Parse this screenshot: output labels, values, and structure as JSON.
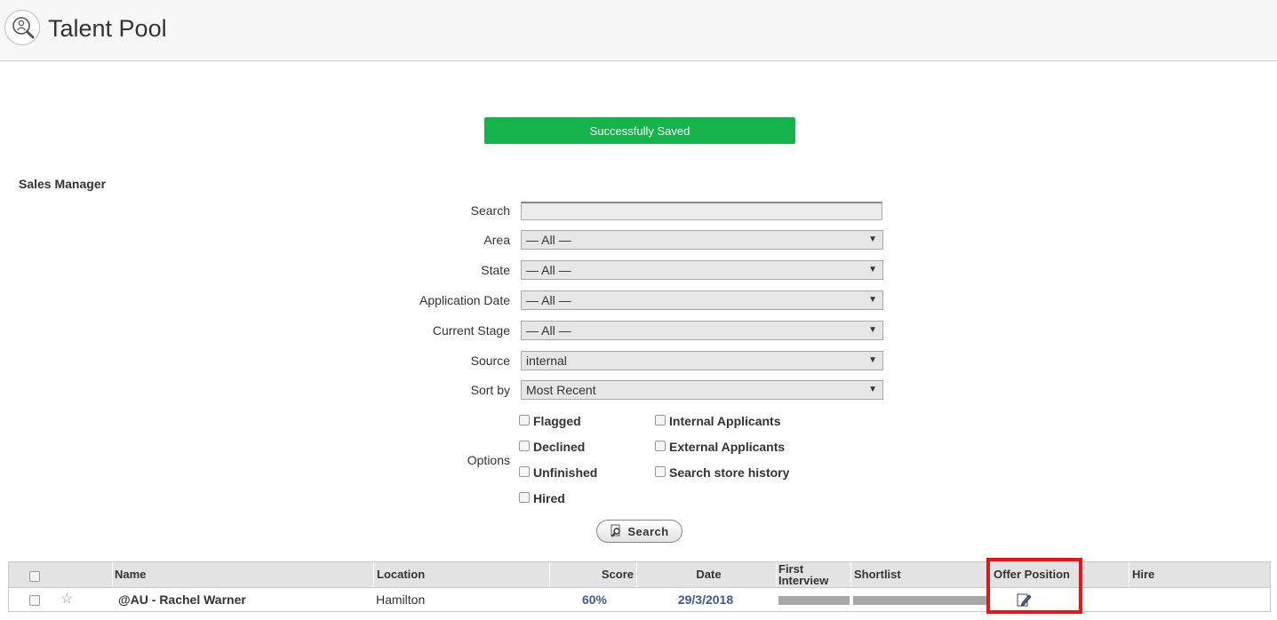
{
  "header": {
    "title": "Talent Pool",
    "logo_icon": "talent-search-icon"
  },
  "toast": {
    "message": "Successfully Saved",
    "color": "#16b24b"
  },
  "section": {
    "title": "Sales Manager"
  },
  "filters": {
    "search_label": "Search",
    "search_value": "",
    "area_label": "Area",
    "area_value": "— All —",
    "state_label": "State",
    "state_value": "— All —",
    "appdate_label": "Application Date",
    "appdate_value": "— All —",
    "stage_label": "Current Stage",
    "stage_value": "— All —",
    "source_label": "Source",
    "source_value": "internal",
    "sort_label": "Sort by",
    "sort_value": "Most Recent",
    "arrow": "▼"
  },
  "options": {
    "label": "Options",
    "flagged": "Flagged",
    "declined": "Declined",
    "unfinished": "Unfinished",
    "hired": "Hired",
    "internal": "Internal Applicants",
    "external": "External Applicants",
    "store_history": "Search store history"
  },
  "search_button": {
    "label": "Search",
    "icon": "search-doc-icon"
  },
  "table": {
    "headers": {
      "name": "Name",
      "location": "Location",
      "score": "Score",
      "date": "Date",
      "first_interview_1": "First",
      "first_interview_2": "Interview",
      "shortlist": "Shortlist",
      "offer_position": "Offer Position",
      "hire": "Hire"
    },
    "rows": [
      {
        "name": "@AU - Rachel Warner",
        "location": "Hamilton",
        "score": "60%",
        "date": "29/3/2018",
        "star": "☆"
      }
    ],
    "link_color": "#3a5a9a"
  },
  "highlight_color": "#e8141a"
}
